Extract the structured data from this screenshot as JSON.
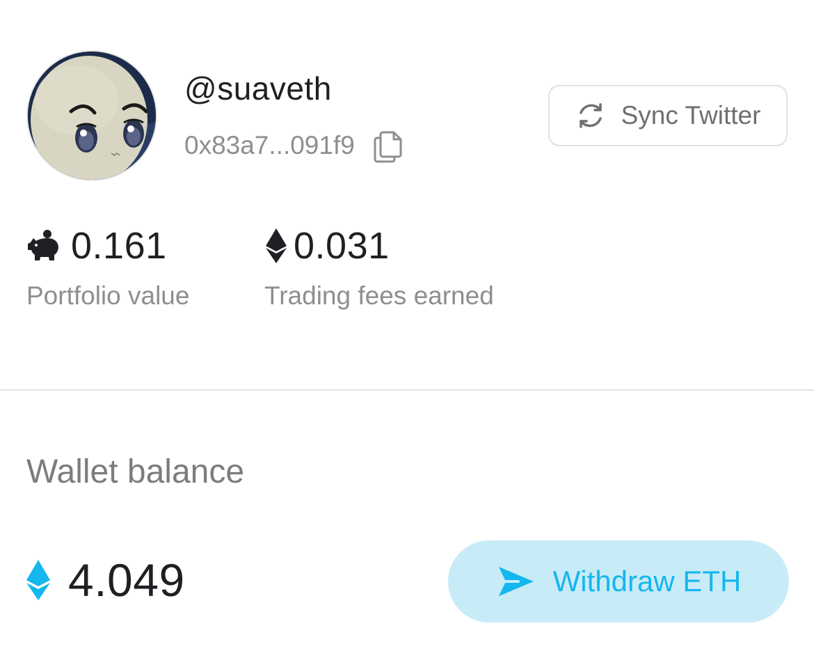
{
  "profile": {
    "username": "@suaveth",
    "address": "0x83a7...091f9",
    "avatar_icon": "avatar-character"
  },
  "sync_button": {
    "label": "Sync Twitter",
    "icon": "sync-icon"
  },
  "stats": {
    "portfolio": {
      "value": "0.161",
      "caption": "Portfolio value",
      "icon": "piggy-bank-icon"
    },
    "fees": {
      "value": "0.031",
      "caption": "Trading fees earned",
      "icon": "ethereum-icon"
    }
  },
  "wallet": {
    "label": "Wallet balance",
    "balance": "4.049",
    "icon": "ethereum-icon"
  },
  "withdraw_button": {
    "label": "Withdraw ETH",
    "icon": "send-icon"
  },
  "colors": {
    "accent": "#14b7ee",
    "accent_bg": "#c8ebf8",
    "text_primary": "#1f1f24",
    "text_secondary": "#8e8e8e",
    "divider": "#e2e2e2"
  }
}
